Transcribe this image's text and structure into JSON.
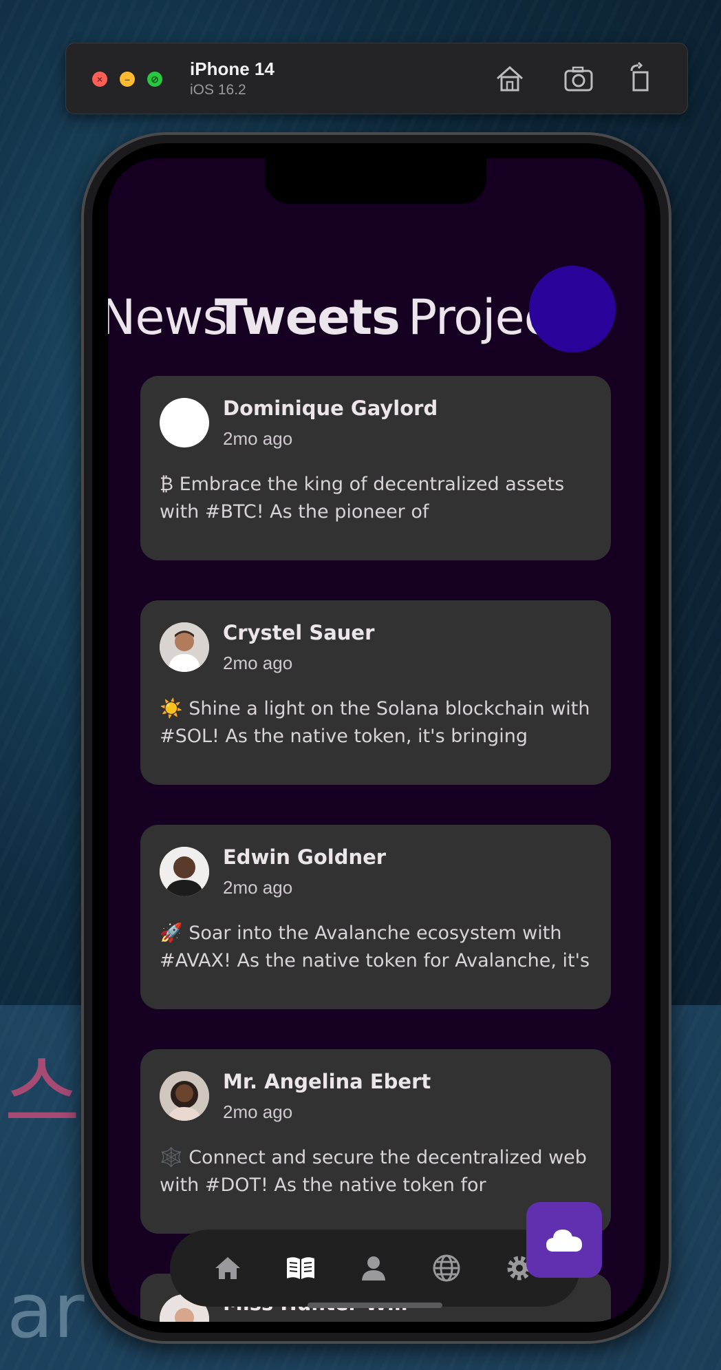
{
  "simulator": {
    "device": "iPhone 14",
    "os": "iOS 16.2",
    "icons": [
      "home-icon",
      "screenshot-icon",
      "rotate-icon"
    ]
  },
  "tabs": [
    {
      "label": "News"
    },
    {
      "label": "Tweets",
      "selected": true
    },
    {
      "label": "Projects"
    }
  ],
  "tweets": [
    {
      "name": "Dominique Gaylord",
      "time": "2mo ago",
      "text": "₿ Embrace the king of decentralized assets with #BTC! As the pioneer of",
      "avatar": "blank-avatar"
    },
    {
      "name": "Crystel Sauer",
      "time": "2mo ago",
      "text": "☀️ Shine a light on the Solana blockchain with #SOL! As the native token, it's bringing",
      "avatar": "person-avatar"
    },
    {
      "name": "Edwin Goldner",
      "time": "2mo ago",
      "text": "🚀 Soar into the Avalanche ecosystem with #AVAX! As the native token for Avalanche, it's",
      "avatar": "person-avatar"
    },
    {
      "name": "Mr. Angelina Ebert",
      "time": "2mo ago",
      "text": "🕸️ Connect and secure the decentralized web with #DOT! As the native token for",
      "avatar": "person-avatar"
    }
  ],
  "partial_tweet": {
    "name": "Miss Hunter Will"
  },
  "navbar": {
    "items": [
      "home-icon",
      "news-icon",
      "profile-icon",
      "globe-icon",
      "settings-icon"
    ],
    "active": "news-icon"
  },
  "fab": {
    "icon": "cloud-icon"
  },
  "colors": {
    "screen_bg": "#150022",
    "card_bg": "#323232",
    "accent_circle": "#2a049a",
    "fab_bg": "#6030b0"
  }
}
